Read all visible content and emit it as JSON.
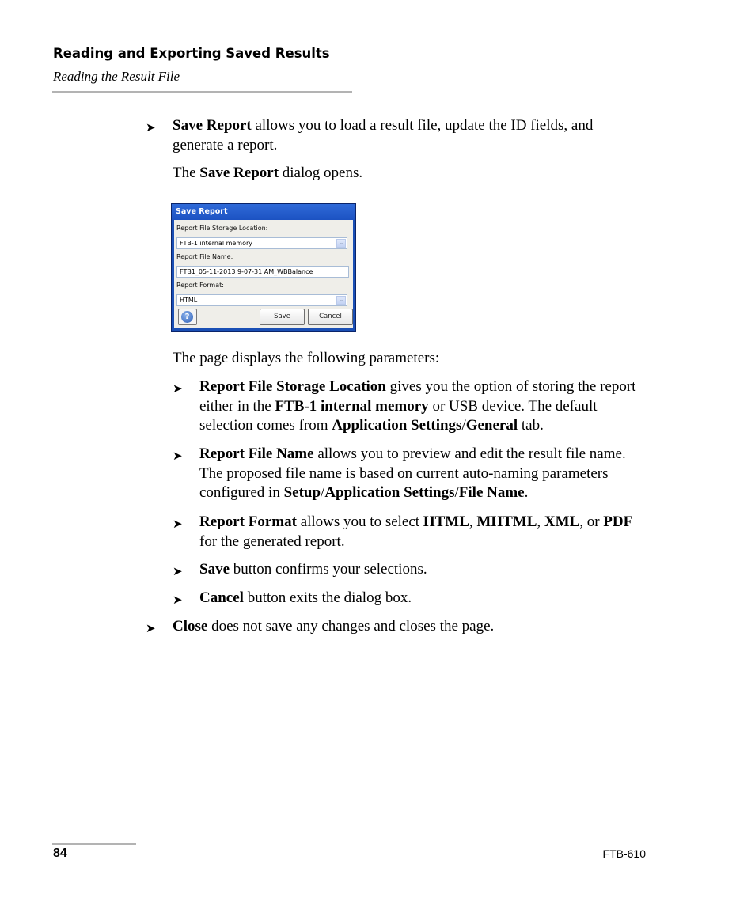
{
  "header": {
    "chapter_title": "Reading and Exporting Saved Results",
    "section_title": "Reading the Result File"
  },
  "bullet_glyph": "➤",
  "content": {
    "save_report": {
      "term": "Save Report",
      "text": " allows you to load a result file, update the ID fields, and generate a report."
    },
    "dialog_opens": {
      "pre": "The ",
      "term": "Save Report",
      "post": " dialog opens."
    },
    "params_intro": "The page displays the following parameters:",
    "params": [
      {
        "parts": [
          {
            "b": "Report File Storage Location"
          },
          {
            "t": " gives you the option of storing the report either in the "
          },
          {
            "b": "FTB-1 internal memory"
          },
          {
            "t": " or USB device. The default selection comes from "
          },
          {
            "b": "Application Settings"
          },
          {
            "t": "/"
          },
          {
            "b": "General"
          },
          {
            "t": " tab."
          }
        ]
      },
      {
        "parts": [
          {
            "b": "Report File Name"
          },
          {
            "t": " allows you to preview and edit the result file name. The proposed file name is based on current auto-naming parameters configured in "
          },
          {
            "b": "Setup"
          },
          {
            "t": "/"
          },
          {
            "b": "Application Settings"
          },
          {
            "t": "/"
          },
          {
            "b": "File Name"
          },
          {
            "t": "."
          }
        ]
      },
      {
        "parts": [
          {
            "b": "Report Format"
          },
          {
            "t": " allows you to select "
          },
          {
            "b": "HTML"
          },
          {
            "t": ", "
          },
          {
            "b": "MHTML"
          },
          {
            "t": ", "
          },
          {
            "b": "XML"
          },
          {
            "t": ", or "
          },
          {
            "b": "PDF"
          },
          {
            "t": " for the generated report."
          }
        ]
      },
      {
        "parts": [
          {
            "b": "Save"
          },
          {
            "t": " button confirms your selections."
          }
        ]
      },
      {
        "parts": [
          {
            "b": "Cancel"
          },
          {
            "t": " button exits the dialog box."
          }
        ]
      }
    ],
    "close": {
      "term": "Close",
      "text": " does not save any changes and closes the page."
    }
  },
  "dialog": {
    "title": "Save Report",
    "storage_label": "Report File Storage Location:",
    "storage_value": "FTB-1 internal memory",
    "name_label": "Report File Name:",
    "name_value": "FTB1_05-11-2013 9-07-31 AM_WBBalance",
    "format_label": "Report Format:",
    "format_value": "HTML",
    "dropdown_glyph": "⌄",
    "help_glyph": "?",
    "save_label": "Save",
    "cancel_label": "Cancel"
  },
  "footer": {
    "page_number": "84",
    "doc_id": "FTB-610"
  }
}
